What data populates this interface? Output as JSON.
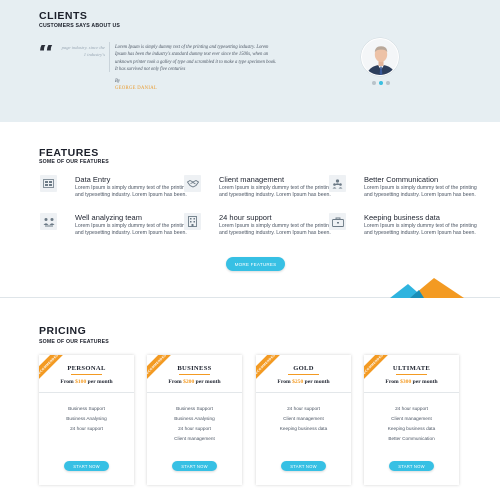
{
  "clients": {
    "title": "CLIENTS",
    "subtitle": "CUSTOMERS SAYS ABOUT US",
    "ghost_text": "page industry. since the 1 industry's",
    "quote": "Lorem Ipsum is simply dummy text of the printing and typesetting industry. Lorem Ipsum has been the industry's standard dummy text ever since the 1500s, when an unknown printer took a galley of type and scrambled it to make a type specimen book. It has survived not only five centuries",
    "by_label": "By",
    "author": "GEORGE DANIAL",
    "carousel_dots": 3,
    "active_dot": 1
  },
  "features": {
    "title": "FEATURES",
    "subtitle": "SOME OF OUR FEATURES",
    "items": [
      {
        "title": "Data Entry",
        "desc": "Lorem Ipsum is simply dummy text of the printing and typesetting industry. Lorem Ipsum has been.",
        "icon": "database-icon"
      },
      {
        "title": "Client management",
        "desc": "Lorem Ipsum is simply dummy text of the printing and typesetting industry. Lorem Ipsum has been.",
        "icon": "handshake-icon"
      },
      {
        "title": "Better Communication",
        "desc": "Lorem Ipsum is simply dummy text of the printing and typesetting industry. Lorem Ipsum has been.",
        "icon": "people-icon"
      },
      {
        "title": "Well analyzing team",
        "desc": "Lorem Ipsum is simply dummy text of the printing and typesetting industry. Lorem Ipsum has been.",
        "icon": "team-icon"
      },
      {
        "title": "24 hour support",
        "desc": "Lorem Ipsum is simply dummy text of the printing and typesetting industry. Lorem Ipsum has been.",
        "icon": "building-icon"
      },
      {
        "title": "Keeping business data",
        "desc": "Lorem Ipsum is simply dummy text of the printing and typesetting industry. Lorem Ipsum has been.",
        "icon": "briefcase-icon"
      }
    ],
    "more_button": "MORE FEATURES"
  },
  "pricing": {
    "title": "PRICING",
    "subtitle": "SOME OF OUR FEATURES",
    "from_label": "From",
    "per_label": "per month",
    "button_label": "START NOW",
    "ribbon": "RECOMMENDED",
    "plans": [
      {
        "name": "PERSONAL",
        "price": "$100",
        "features": [
          "Business Support",
          "Business Analysing",
          "24 hour support"
        ]
      },
      {
        "name": "BUSINESS",
        "price": "$200",
        "features": [
          "Business Support",
          "Business Analysing",
          "24 hour support",
          "Client management"
        ]
      },
      {
        "name": "GOLD",
        "price": "$250",
        "features": [
          "24 hour support",
          "Client management",
          "Keeping business data"
        ]
      },
      {
        "name": "ULTIMATE",
        "price": "$300",
        "features": [
          "24 hour support",
          "Client management",
          "Keeping business data",
          "Better Communication"
        ]
      }
    ]
  },
  "colors": {
    "accent_blue": "#37c0e4",
    "accent_orange": "#f39a22",
    "clients_bg": "#e6eef2"
  }
}
